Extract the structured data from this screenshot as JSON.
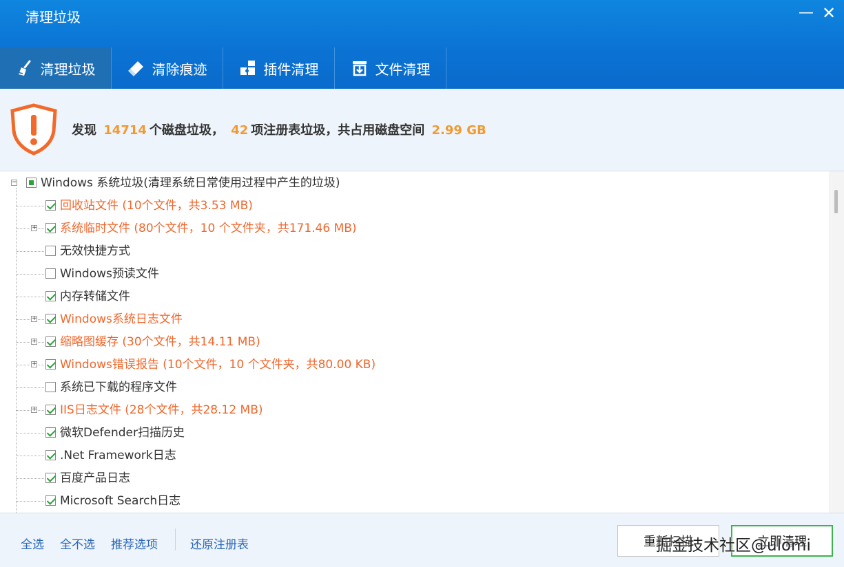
{
  "window": {
    "title": "清理垃圾",
    "minimize_glyph": "—",
    "close_glyph": "✕"
  },
  "tabs": [
    {
      "label": "清理垃圾",
      "icon": "broom-icon",
      "active": true
    },
    {
      "label": "清除痕迹",
      "icon": "eraser-icon",
      "active": false
    },
    {
      "label": "插件清理",
      "icon": "puzzle-icon",
      "active": false
    },
    {
      "label": "文件清理",
      "icon": "file-download-icon",
      "active": false
    }
  ],
  "summary": {
    "icon": "warning-shield-icon",
    "prefix": "发现",
    "disk_count": "14714",
    "disk_text": "个磁盘垃圾，",
    "reg_count": "42",
    "reg_text": "项注册表垃圾，共占用磁盘空间",
    "size": "2.99 GB"
  },
  "tree": {
    "root": {
      "label": "Windows 系统垃圾(清理系统日常使用过程中产生的垃圾)",
      "state": "partial",
      "expand": "⊟"
    },
    "items": [
      {
        "label": "回收站文件 (10个文件，共3.53 MB)",
        "checked": true,
        "expandable": false,
        "highlight": true
      },
      {
        "label": "系统临时文件 (80个文件，10 个文件夹，共171.46 MB)",
        "checked": true,
        "expandable": true,
        "highlight": true
      },
      {
        "label": "无效快捷方式",
        "checked": false,
        "expandable": false,
        "highlight": false
      },
      {
        "label": "Windows预读文件",
        "checked": false,
        "expandable": false,
        "highlight": false
      },
      {
        "label": "内存转储文件",
        "checked": true,
        "expandable": false,
        "highlight": false
      },
      {
        "label": "Windows系统日志文件",
        "checked": true,
        "expandable": true,
        "highlight": true
      },
      {
        "label": "缩略图缓存 (30个文件，共14.11 MB)",
        "checked": true,
        "expandable": true,
        "highlight": true
      },
      {
        "label": "Windows错误报告 (10个文件，10 个文件夹，共80.00 KB)",
        "checked": true,
        "expandable": true,
        "highlight": true
      },
      {
        "label": "系统已下载的程序文件",
        "checked": false,
        "expandable": false,
        "highlight": false
      },
      {
        "label": "IIS日志文件 (28个文件，共28.12 MB)",
        "checked": true,
        "expandable": true,
        "highlight": true
      },
      {
        "label": "微软Defender扫描历史",
        "checked": true,
        "expandable": false,
        "highlight": false
      },
      {
        "label": ".Net Framework日志",
        "checked": true,
        "expandable": false,
        "highlight": false
      },
      {
        "label": "百度产品日志",
        "checked": true,
        "expandable": false,
        "highlight": false
      },
      {
        "label": "Microsoft Search日志",
        "checked": true,
        "expandable": false,
        "highlight": false
      }
    ]
  },
  "footer": {
    "select_all": "全选",
    "select_none": "全不选",
    "recommended": "推荐选项",
    "restore_registry": "还原注册表",
    "restart_button": "重新扫描",
    "clean_button": "立即清理",
    "watermark": "掘金技术社区@ulomi"
  },
  "colors": {
    "header_blue": "#0b73d4",
    "active_tab": "#1f6fb5",
    "highlight_text": "#f0672d",
    "number_orange": "#f19a32",
    "link_blue": "#2a67b8",
    "check_green": "#2e9f3b"
  }
}
